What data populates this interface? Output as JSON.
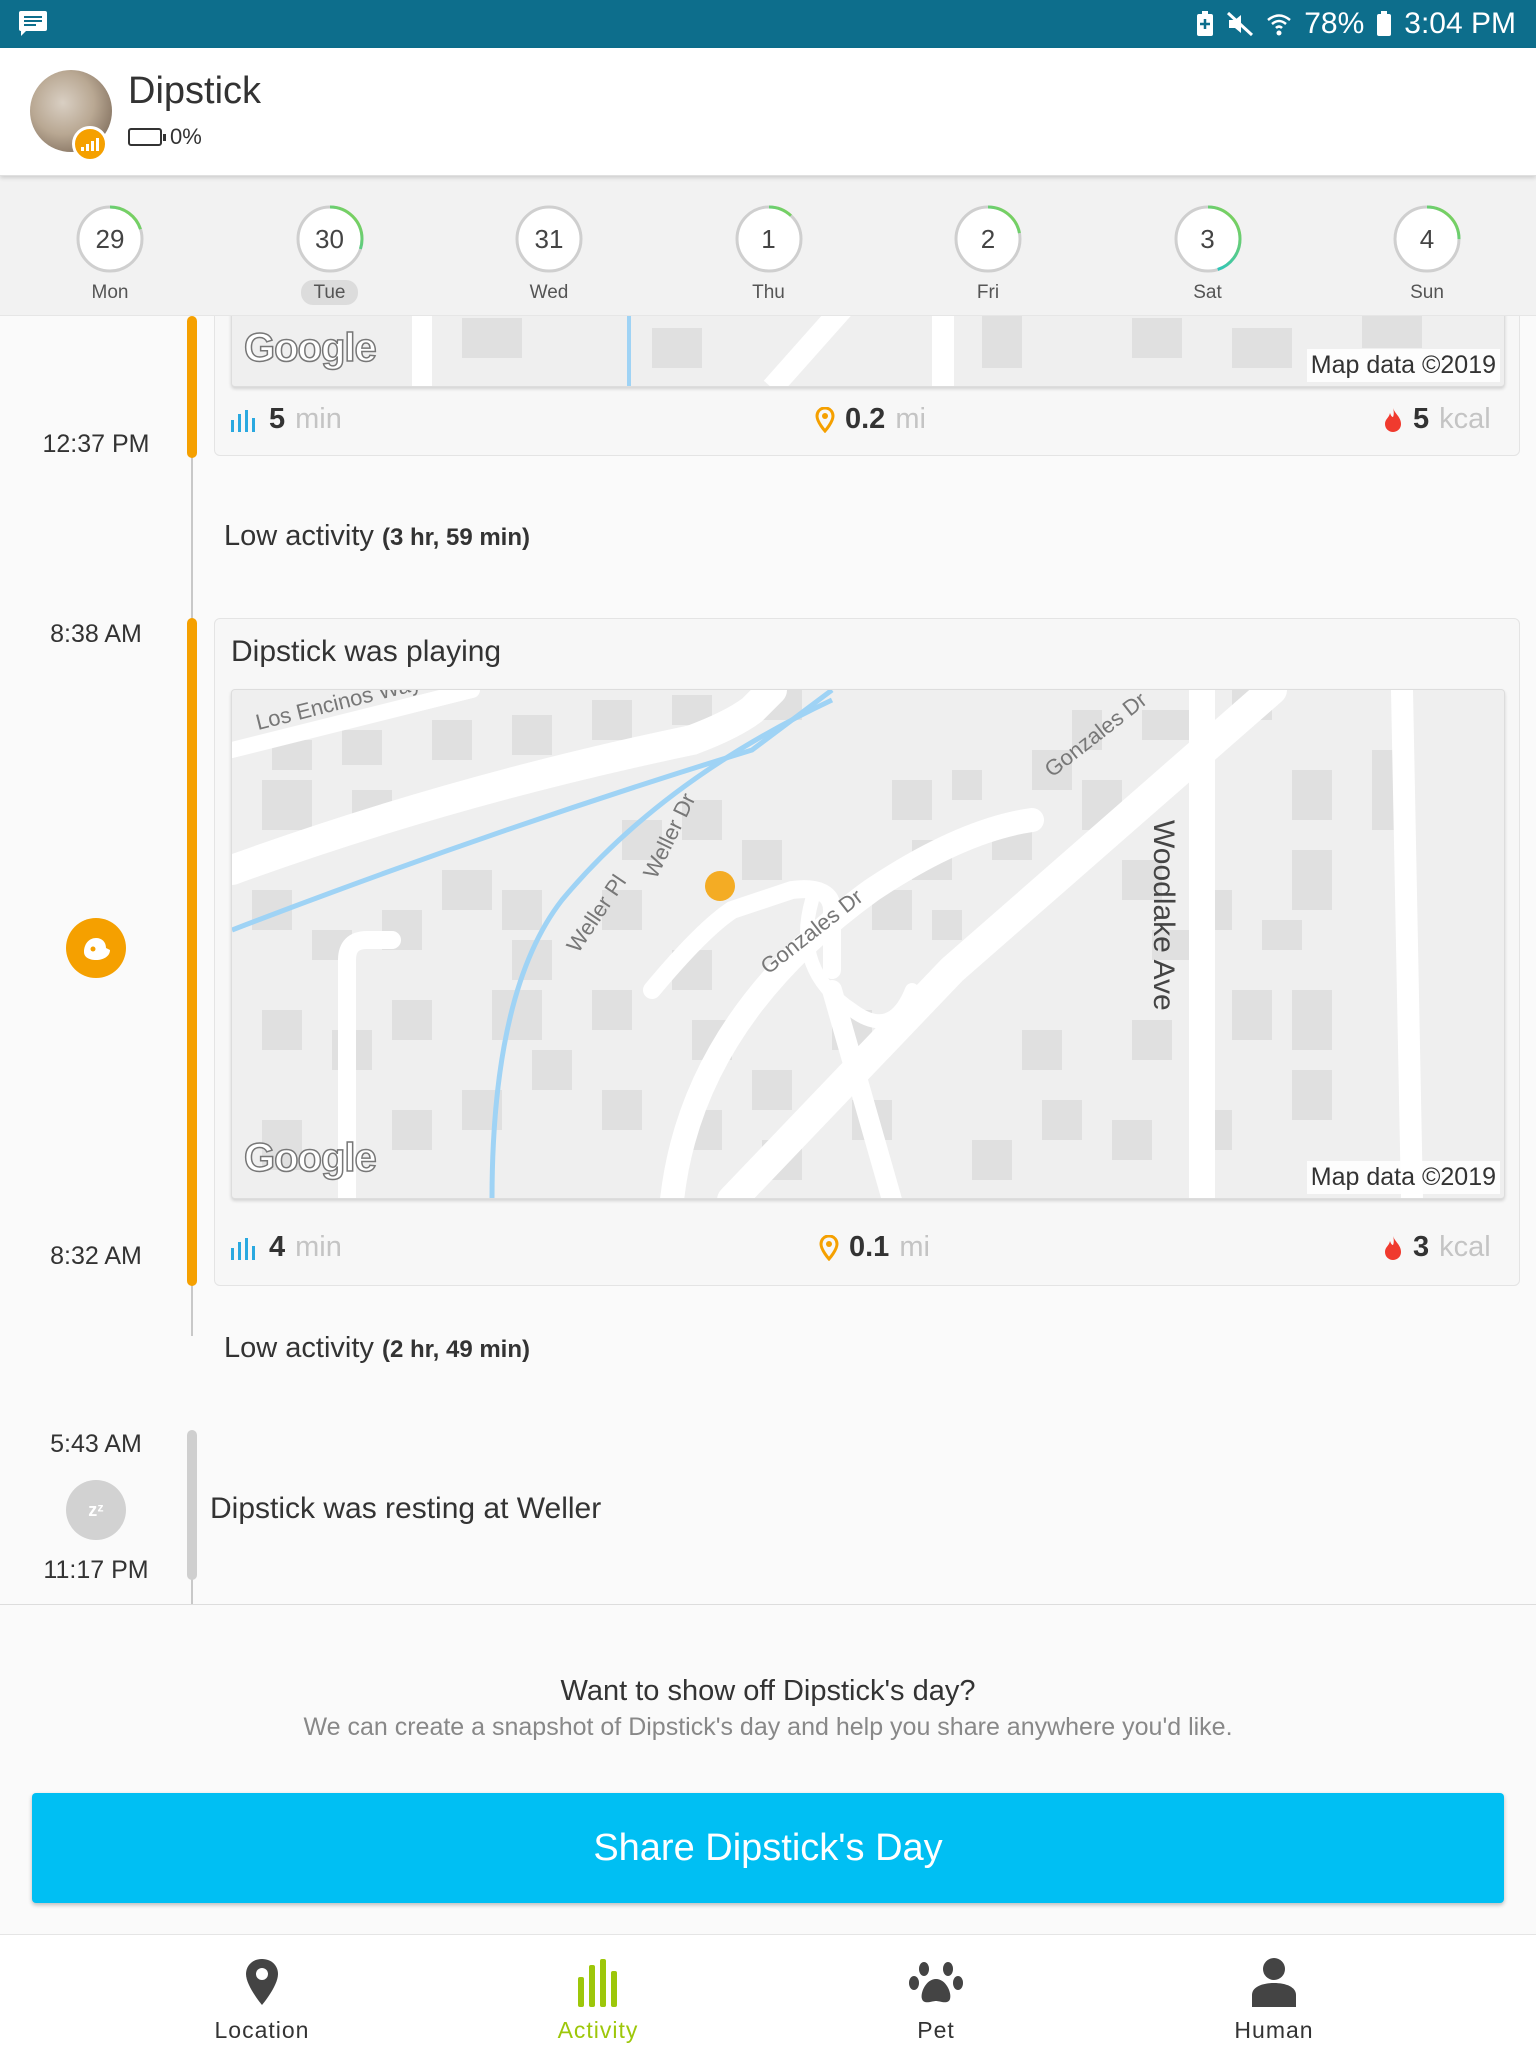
{
  "status_bar": {
    "battery_percent": "78%",
    "time": "3:04 PM",
    "icons": [
      "message-icon",
      "battery-saver-icon",
      "mute-icon",
      "wifi-icon",
      "battery-icon"
    ]
  },
  "pet": {
    "name": "Dipstick",
    "battery": "0%"
  },
  "days": [
    {
      "num": "29",
      "weekday": "Mon",
      "progress": 0.2,
      "selected": false
    },
    {
      "num": "30",
      "weekday": "Tue",
      "progress": 0.3,
      "selected": true
    },
    {
      "num": "31",
      "weekday": "Wed",
      "progress": 0.0,
      "selected": false
    },
    {
      "num": "1",
      "weekday": "Thu",
      "progress": 0.12,
      "selected": false
    },
    {
      "num": "2",
      "weekday": "Fri",
      "progress": 0.22,
      "selected": false
    },
    {
      "num": "3",
      "weekday": "Sat",
      "progress": 0.45,
      "selected": false
    },
    {
      "num": "4",
      "weekday": "Sun",
      "progress": 0.25,
      "selected": false
    }
  ],
  "colors": {
    "ring_track": "#cfcfcf",
    "ring_progress_start": "#00bff3",
    "ring_progress_end": "#8bd34a",
    "activity_orange": "#f5a000",
    "share_blue": "#00bff3",
    "active_green": "#9dc70a",
    "stat_blue": "#2aa9e0",
    "stat_red": "#f03a2e"
  },
  "timeline": {
    "first_card": {
      "end_time": "12:37 PM",
      "map_logo": "Google",
      "map_data": "Map data ©2019",
      "duration_value": "5",
      "duration_unit": "min",
      "distance_value": "0.2",
      "distance_unit": "mi",
      "calories_value": "5",
      "calories_unit": "kcal"
    },
    "low1": {
      "label": "Low activity",
      "detail": "(3 hr, 59 min)"
    },
    "play": {
      "start_time": "8:38 AM",
      "end_time": "8:32 AM",
      "title": "Dipstick was playing",
      "map_logo": "Google",
      "map_data": "Map data ©2019",
      "streets": {
        "los_encinos": "Los Encinos Way",
        "gonzales_upper": "Gonzales Dr",
        "gonzales_lower": "Gonzales Dr",
        "weller_dr": "Weller Dr",
        "weller_pl": "Weller Pl",
        "woodlake": "Woodlake Ave"
      },
      "duration_value": "4",
      "duration_unit": "min",
      "distance_value": "0.1",
      "distance_unit": "mi",
      "calories_value": "3",
      "calories_unit": "kcal"
    },
    "low2": {
      "label": "Low activity",
      "detail": "(2 hr, 49 min)"
    },
    "rest": {
      "start_time": "5:43 AM",
      "end_time": "11:17 PM",
      "title": "Dipstick was resting at Weller",
      "sleep_glyph": "zᶻ"
    }
  },
  "share": {
    "title": "Want to show off Dipstick's day?",
    "subtitle": "We can create a snapshot of Dipstick's day and help you share anywhere you'd like.",
    "button": "Share Dipstick's Day"
  },
  "nav": [
    {
      "label": "Location",
      "icon": "location-pin-icon",
      "active": false
    },
    {
      "label": "Activity",
      "icon": "activity-bars-icon",
      "active": true
    },
    {
      "label": "Pet",
      "icon": "paw-icon",
      "active": false
    },
    {
      "label": "Human",
      "icon": "person-icon",
      "active": false
    }
  ]
}
